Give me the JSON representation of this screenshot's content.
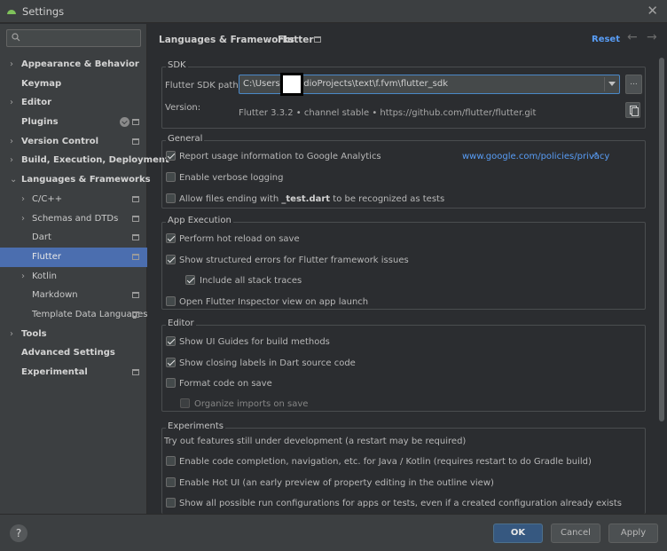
{
  "window": {
    "title": "Settings",
    "close_glyph": "✕"
  },
  "sidebar": {
    "search_placeholder": "",
    "items": [
      {
        "label": "Appearance & Behavior",
        "arrow": "›"
      },
      {
        "label": "Keymap"
      },
      {
        "label": "Editor",
        "arrow": "›"
      },
      {
        "label": "Plugins"
      },
      {
        "label": "Version Control",
        "arrow": "›"
      },
      {
        "label": "Build, Execution, Deployment",
        "arrow": "›"
      },
      {
        "label": "Languages & Frameworks",
        "arrow": "⌄"
      },
      {
        "label": "C/C++",
        "arrow": "›"
      },
      {
        "label": "Schemas and DTDs",
        "arrow": "›"
      },
      {
        "label": "Dart"
      },
      {
        "label": "Flutter"
      },
      {
        "label": "Kotlin",
        "arrow": "›"
      },
      {
        "label": "Markdown"
      },
      {
        "label": "Template Data Languages"
      },
      {
        "label": "Tools",
        "arrow": "›"
      },
      {
        "label": "Advanced Settings"
      },
      {
        "label": "Experimental"
      }
    ]
  },
  "header": {
    "breadcrumb_parent": "Languages & Frameworks",
    "breadcrumb_sep": "›",
    "breadcrumb_current": "Flutter",
    "reset_label": "Reset",
    "back_glyph": "←",
    "forward_glyph": "→"
  },
  "sdk": {
    "title": "SDK",
    "path_label": "Flutter SDK path:",
    "path_value": "C:\\Users\\        \\StudioProjects\\text\\f.fvm\\flutter_sdk",
    "browse_label": "...",
    "version_label": "Version:",
    "version_value": "Flutter 3.3.2 • channel stable • https://github.com/flutter/flutter.git"
  },
  "general": {
    "title": "General",
    "analytics_label": "Report usage information to Google Analytics",
    "analytics_link": "www.google.com/policies/privacy",
    "link_glyph": "↗",
    "verbose_label": "Enable verbose logging",
    "allow_prefix": "Allow files ending with",
    "allow_bold": "_test.dart",
    "allow_suffix": "to be recognized as tests"
  },
  "app_execution": {
    "title": "App Execution",
    "hot_reload_label": "Perform hot reload on save",
    "structured_errors_label": "Show structured errors for Flutter framework issues",
    "stack_traces_label": "Include all stack traces",
    "inspector_label": "Open Flutter Inspector view on app launch"
  },
  "editor": {
    "title": "Editor",
    "ui_guides_label": "Show UI Guides for build methods",
    "closing_labels_label": "Show closing labels in Dart source code",
    "format_label": "Format code on save",
    "organize_label": "Organize imports on save"
  },
  "experiments": {
    "title": "Experiments",
    "description": "Try out features still under development (a restart may be required)",
    "code_completion_label": "Enable code completion, navigation, etc. for Java / Kotlin (requires restart to do Gradle build)",
    "hot_ui_label": "Enable Hot UI (an early preview of property editing in the outline view)",
    "run_configs_label": "Show all possible run configurations for apps or tests, even if a created configuration already exists"
  },
  "footer": {
    "help_label": "?",
    "ok_label": "OK",
    "cancel_label": "Cancel",
    "apply_label": "Apply"
  },
  "colors": {
    "accent": "#589df6",
    "selection": "#4b6eaf",
    "ok_button": "#365880"
  }
}
